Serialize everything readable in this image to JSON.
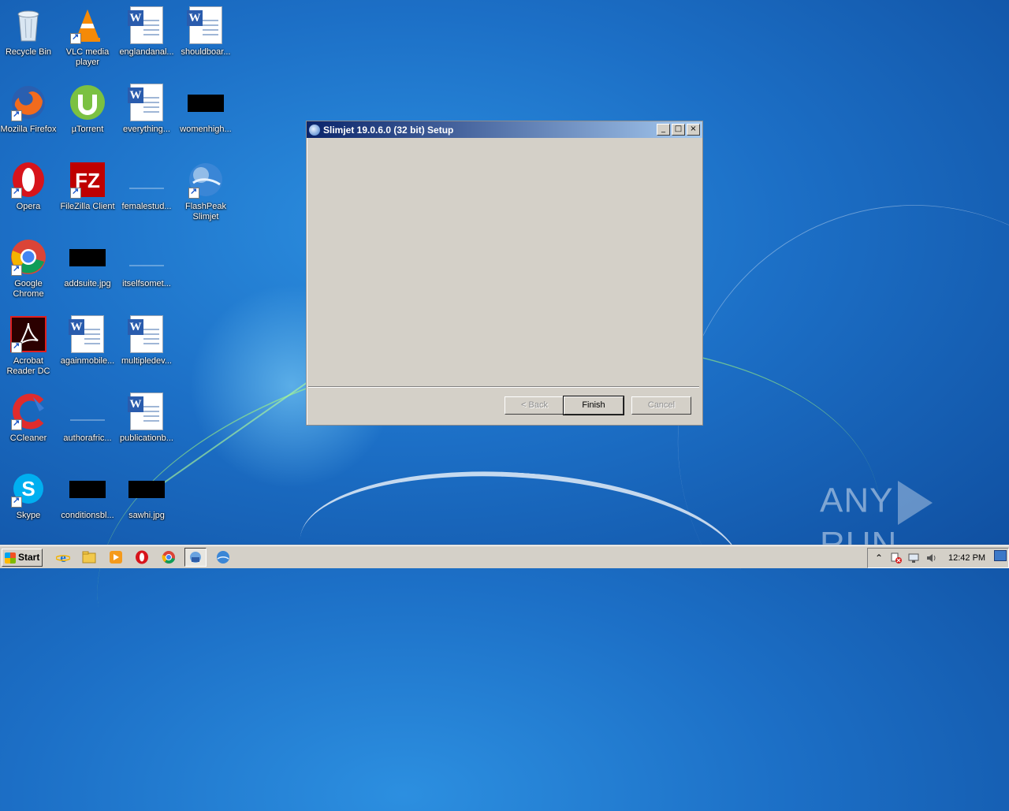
{
  "desktop": {
    "icons": [
      {
        "label": "Recycle Bin"
      },
      {
        "label": "VLC media player"
      },
      {
        "label": "englandanal..."
      },
      {
        "label": "shouldboar..."
      },
      {
        "label": "Mozilla Firefox"
      },
      {
        "label": "µTorrent"
      },
      {
        "label": "everything..."
      },
      {
        "label": "womenhigh..."
      },
      {
        "label": "Opera"
      },
      {
        "label": "FileZilla Client"
      },
      {
        "label": "femalestud..."
      },
      {
        "label": "FlashPeak Slimjet"
      },
      {
        "label": "Google Chrome"
      },
      {
        "label": "addsuite.jpg"
      },
      {
        "label": "itselfsomet..."
      },
      {
        "label": "Acrobat Reader DC"
      },
      {
        "label": "againmobile..."
      },
      {
        "label": "multipledev..."
      },
      {
        "label": "CCleaner"
      },
      {
        "label": "authorafric..."
      },
      {
        "label": "publicationb..."
      },
      {
        "label": "Skype"
      },
      {
        "label": "conditionsbl..."
      },
      {
        "label": "sawhi.jpg"
      }
    ]
  },
  "dialog": {
    "title": "Slimjet 19.0.6.0 (32 bit) Setup",
    "minimize_glyph": "_",
    "maximize_glyph": "□",
    "close_glyph": "×",
    "back_label": "< Back",
    "finish_label": "Finish",
    "cancel_label": "Cancel"
  },
  "watermark": {
    "text_left": "ANY",
    "text_right": "RUN"
  },
  "taskbar": {
    "start_label": "Start",
    "clock": "12:42 PM",
    "pinned": [
      "internet-explorer",
      "file-explorer",
      "media-player",
      "opera",
      "chrome",
      "slimjet-setup",
      "slimjet"
    ]
  },
  "colors": {
    "titlebar_start": "#0a246a",
    "titlebar_end": "#a6caf0",
    "dialog_bg": "#d4d0c8"
  }
}
